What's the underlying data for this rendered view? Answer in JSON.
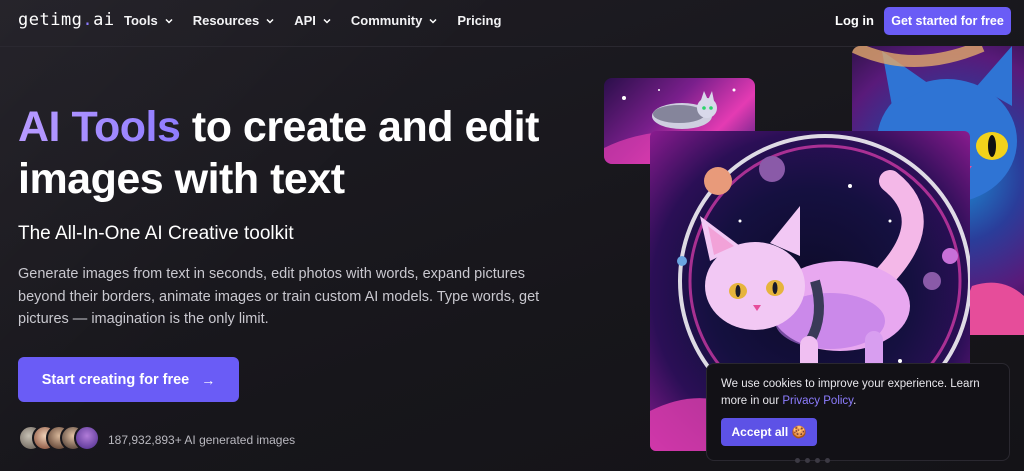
{
  "nav": {
    "logo_main": "getimg",
    "logo_dot": ".",
    "logo_suffix": "ai",
    "items": [
      {
        "label": "Tools",
        "has_dropdown": true
      },
      {
        "label": "Resources",
        "has_dropdown": true
      },
      {
        "label": "API",
        "has_dropdown": true
      },
      {
        "label": "Community",
        "has_dropdown": true
      },
      {
        "label": "Pricing",
        "has_dropdown": false
      }
    ],
    "login": "Log in",
    "get_started": "Get started for free"
  },
  "hero": {
    "title_accent": "AI Tools",
    "title_rest": " to create and edit images with text",
    "subtitle": "The All-In-One AI Creative toolkit",
    "description": "Generate images from text in seconds, edit photos with words, expand pictures beyond their borders, animate images or train custom AI models. Type words, get pictures — imagination is the only limit.",
    "cta": "Start creating for free",
    "cta_arrow": "→",
    "generated_count": "187,932,893+ AI generated images"
  },
  "cookie": {
    "text_before": "We use cookies to improve your experience. Learn more in our ",
    "link": "Privacy Policy",
    "text_after": ".",
    "accept": "Accept all 🍪"
  },
  "colors": {
    "background": "#18171c",
    "accent": "#6a5cf6",
    "link": "#8d7dff"
  }
}
